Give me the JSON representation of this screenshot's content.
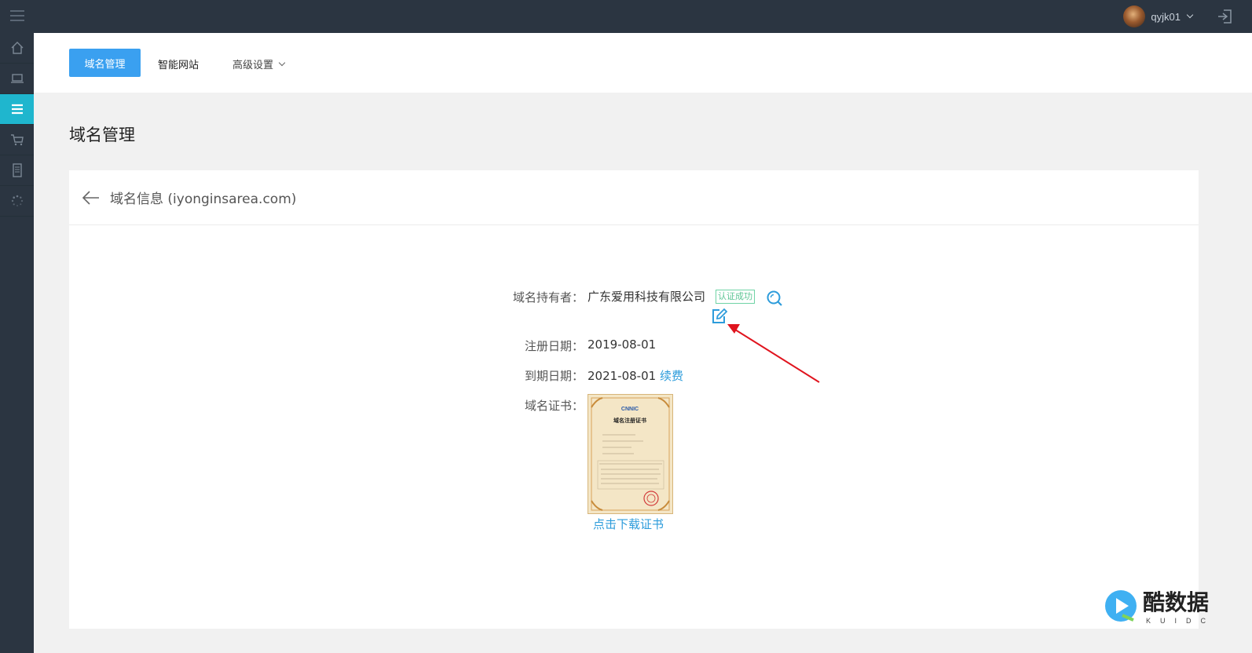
{
  "topbar": {
    "username": "qyjk01"
  },
  "sidebar": {
    "items": [
      {
        "icon": "home-icon"
      },
      {
        "icon": "laptop-icon"
      },
      {
        "icon": "list-icon",
        "active": true
      },
      {
        "icon": "cart-icon"
      },
      {
        "icon": "document-icon"
      },
      {
        "icon": "loading-icon"
      }
    ]
  },
  "nav": {
    "tabs": [
      {
        "label": "域名管理",
        "active": true
      },
      {
        "label": "智能网站"
      },
      {
        "label": "高级设置"
      }
    ]
  },
  "page": {
    "title": "域名管理"
  },
  "card": {
    "title": "域名信息 (iyonginsarea.com)",
    "owner_label": "域名持有者：",
    "owner_value": "广东爱用科技有限公司",
    "verified_badge": "认证成功",
    "register_label": "注册日期：",
    "register_value": "2019-08-01",
    "expire_label": "到期日期：",
    "expire_value": "2021-08-01",
    "renew_link": "续费",
    "cert_label": "域名证书：",
    "cert_logo": "CNNIC",
    "cert_title": "域名注册证书",
    "download_link": "点击下载证书"
  },
  "watermark": {
    "text": "酷数据",
    "sub": "KUIDC"
  },
  "colors": {
    "topbar": "#2b3541",
    "accent": "#3aa0f0",
    "sidebar_active": "#1fb6ce",
    "link": "#2d9cdb",
    "badge": "#5cc594",
    "annotation_arrow": "#e0141e"
  }
}
